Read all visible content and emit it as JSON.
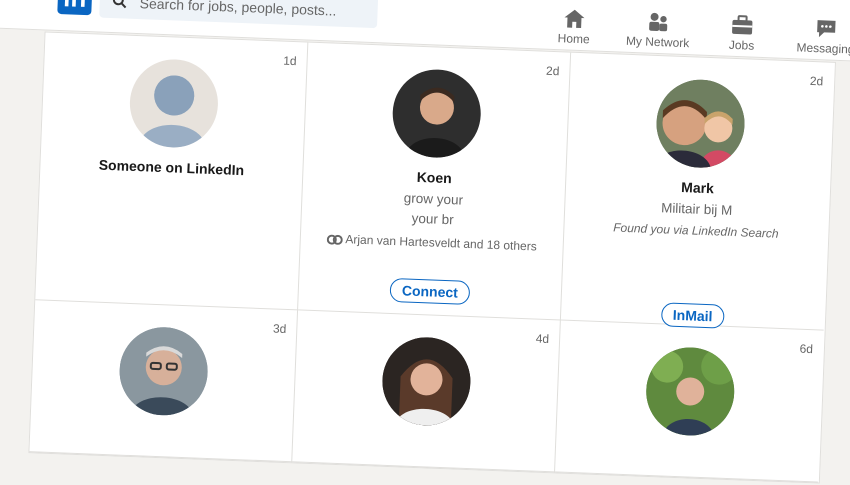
{
  "brand": {
    "logo_text": "in",
    "color": "#0a66c2"
  },
  "search": {
    "placeholder": "Search for jobs, people, posts..."
  },
  "nav": [
    {
      "label": "Home",
      "icon": "home-icon"
    },
    {
      "label": "My Network",
      "icon": "people-icon"
    },
    {
      "label": "Jobs",
      "icon": "briefcase-icon"
    },
    {
      "label": "Messaging",
      "icon": "chat-icon"
    }
  ],
  "cards": [
    {
      "time": "1d",
      "name": "Someone on LinkedIn",
      "avatar": "placeholder"
    },
    {
      "time": "2d",
      "name": "Koen",
      "headline_1": "grow your",
      "headline_2": "your br",
      "mutual": "Arjan van Hartesveldt and 18 others",
      "button": "Connect"
    },
    {
      "time": "2d",
      "name": "Mark",
      "headline_1": "Militair bij M",
      "note": "Found you via LinkedIn Search",
      "button": "InMail"
    },
    {
      "time": "3d"
    },
    {
      "time": "4d"
    },
    {
      "time": "6d"
    }
  ]
}
